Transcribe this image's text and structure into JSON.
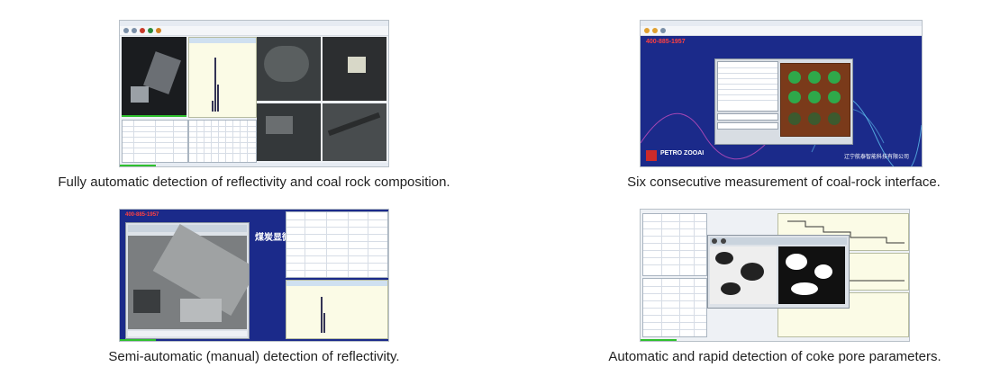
{
  "captions": {
    "top_left": "Fully automatic detection of reflectivity and coal rock composition.",
    "top_right": "Six consecutive measurement of coal-rock interface.",
    "bottom_left": "Semi-automatic (manual) detection of reflectivity.",
    "bottom_right": "Automatic and rapid detection of coke pore parameters."
  },
  "screens": {
    "coal_interface": {
      "phone": "400-885-1957",
      "brand": "PETRO ZOOAI",
      "company": "辽宁航泰智能科技有限公司"
    },
    "semi_auto": {
      "phone": "400-885-1957",
      "title_cn": "煤炭显微分析"
    }
  },
  "colors": {
    "blue_bg": "#1b2a8a",
    "chart_bg": "#fbfbe6",
    "status_green": "#2ec02e"
  }
}
